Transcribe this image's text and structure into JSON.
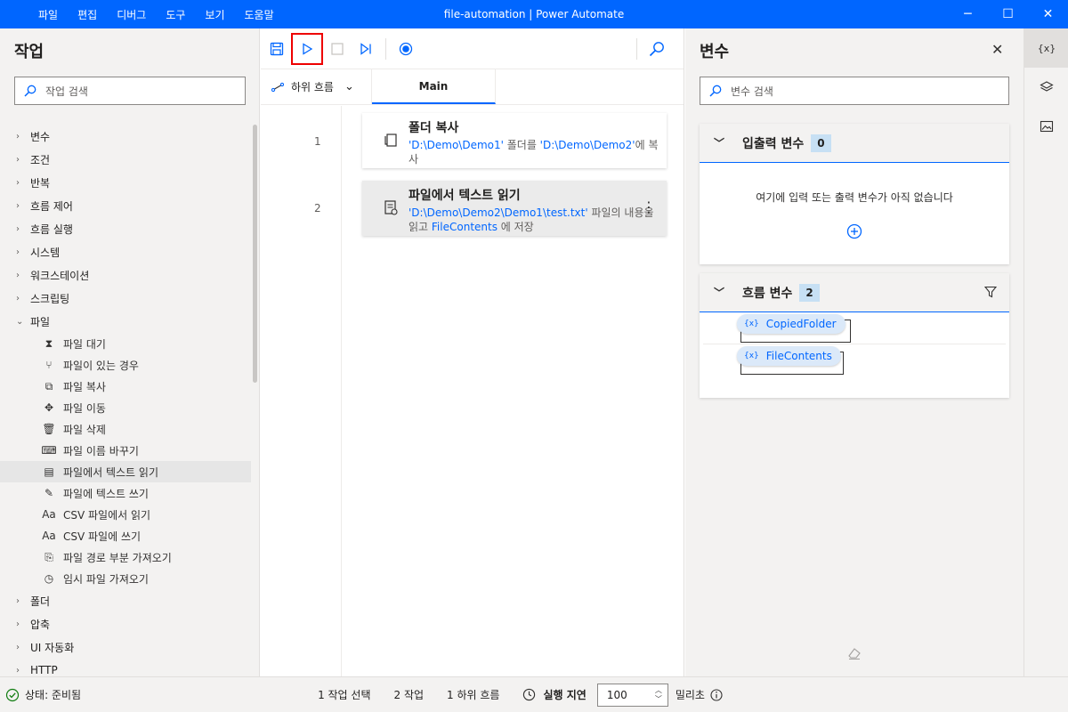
{
  "window": {
    "title": "file-automation | Power Automate",
    "menu": [
      "파일",
      "편집",
      "디버그",
      "도구",
      "보기",
      "도움말"
    ],
    "controls": [
      "─",
      "☐",
      "✕"
    ]
  },
  "actions_panel": {
    "title": "작업",
    "search_placeholder": "작업 검색",
    "categories_top": [
      "변수",
      "조건",
      "반복",
      "흐름 제어",
      "흐름 실행",
      "시스템",
      "워크스테이션",
      "스크립팅"
    ],
    "expanded_category": "파일",
    "file_actions": [
      {
        "label": "파일 대기",
        "icon": "hourglass-icon"
      },
      {
        "label": "파일이 있는 경우",
        "icon": "branch-icon"
      },
      {
        "label": "파일 복사",
        "icon": "copy-icon"
      },
      {
        "label": "파일 이동",
        "icon": "move-icon"
      },
      {
        "label": "파일 삭제",
        "icon": "trash-icon"
      },
      {
        "label": "파일 이름 바꾸기",
        "icon": "rename-icon"
      },
      {
        "label": "파일에서 텍스트 읽기",
        "icon": "read-text-icon"
      },
      {
        "label": "파일에 텍스트 쓰기",
        "icon": "write-text-icon"
      },
      {
        "label": "CSV 파일에서 읽기",
        "icon": "csv-icon"
      },
      {
        "label": "CSV 파일에 쓰기",
        "icon": "csv-icon"
      },
      {
        "label": "파일 경로 부분 가져오기",
        "icon": "path-icon"
      },
      {
        "label": "임시 파일 가져오기",
        "icon": "temp-file-icon"
      }
    ],
    "selected_action_index": 6,
    "categories_bottom": [
      "폴더",
      "압축",
      "UI 자동화",
      "HTTP"
    ]
  },
  "designer": {
    "subflow_label": "하위 흐름",
    "tab_main": "Main",
    "steps": [
      {
        "number": "1",
        "title": "폴더 복사",
        "desc_parts": [
          {
            "text": "'D:\\Demo\\Demo1'",
            "var": true
          },
          {
            "text": " 폴더를 ",
            "var": false
          },
          {
            "text": "'D:\\Demo\\Demo2'",
            "var": true
          },
          {
            "text": "에 복사",
            "var": false
          }
        ]
      },
      {
        "number": "2",
        "title": "파일에서 텍스트 읽기",
        "desc_parts": [
          {
            "text": "'D:\\Demo\\Demo2\\Demo1\\test.txt'",
            "var": true
          },
          {
            "text": " 파일의 내용을 읽고 ",
            "var": false
          },
          {
            "text": " FileContents ",
            "var": true
          },
          {
            "text": " 에 저장",
            "var": false
          }
        ]
      }
    ]
  },
  "variables_panel": {
    "title": "변수",
    "search_placeholder": "변수 검색",
    "io_section": {
      "title": "입출력 변수",
      "count": "0",
      "empty_text": "여기에 입력 또는 출력 변수가 아직 없습니다"
    },
    "flow_section": {
      "title": "흐름 변수",
      "count": "2",
      "items": [
        "CopiedFolder",
        "FileContents"
      ]
    }
  },
  "rail": {
    "items": [
      "{x}",
      "layers-icon",
      "image-icon"
    ]
  },
  "status_bar": {
    "status": "상태: 준비됨",
    "selected": "1 작업 선택",
    "actions": "2 작업",
    "subflows": "1 하위 흐름",
    "delay_label": "실행 지연",
    "delay_value": "100",
    "delay_unit": "밀리초"
  },
  "colors": {
    "accent": "#0066ff",
    "panel_bg": "#f3f2f1",
    "badge": "#c7e0f4"
  }
}
